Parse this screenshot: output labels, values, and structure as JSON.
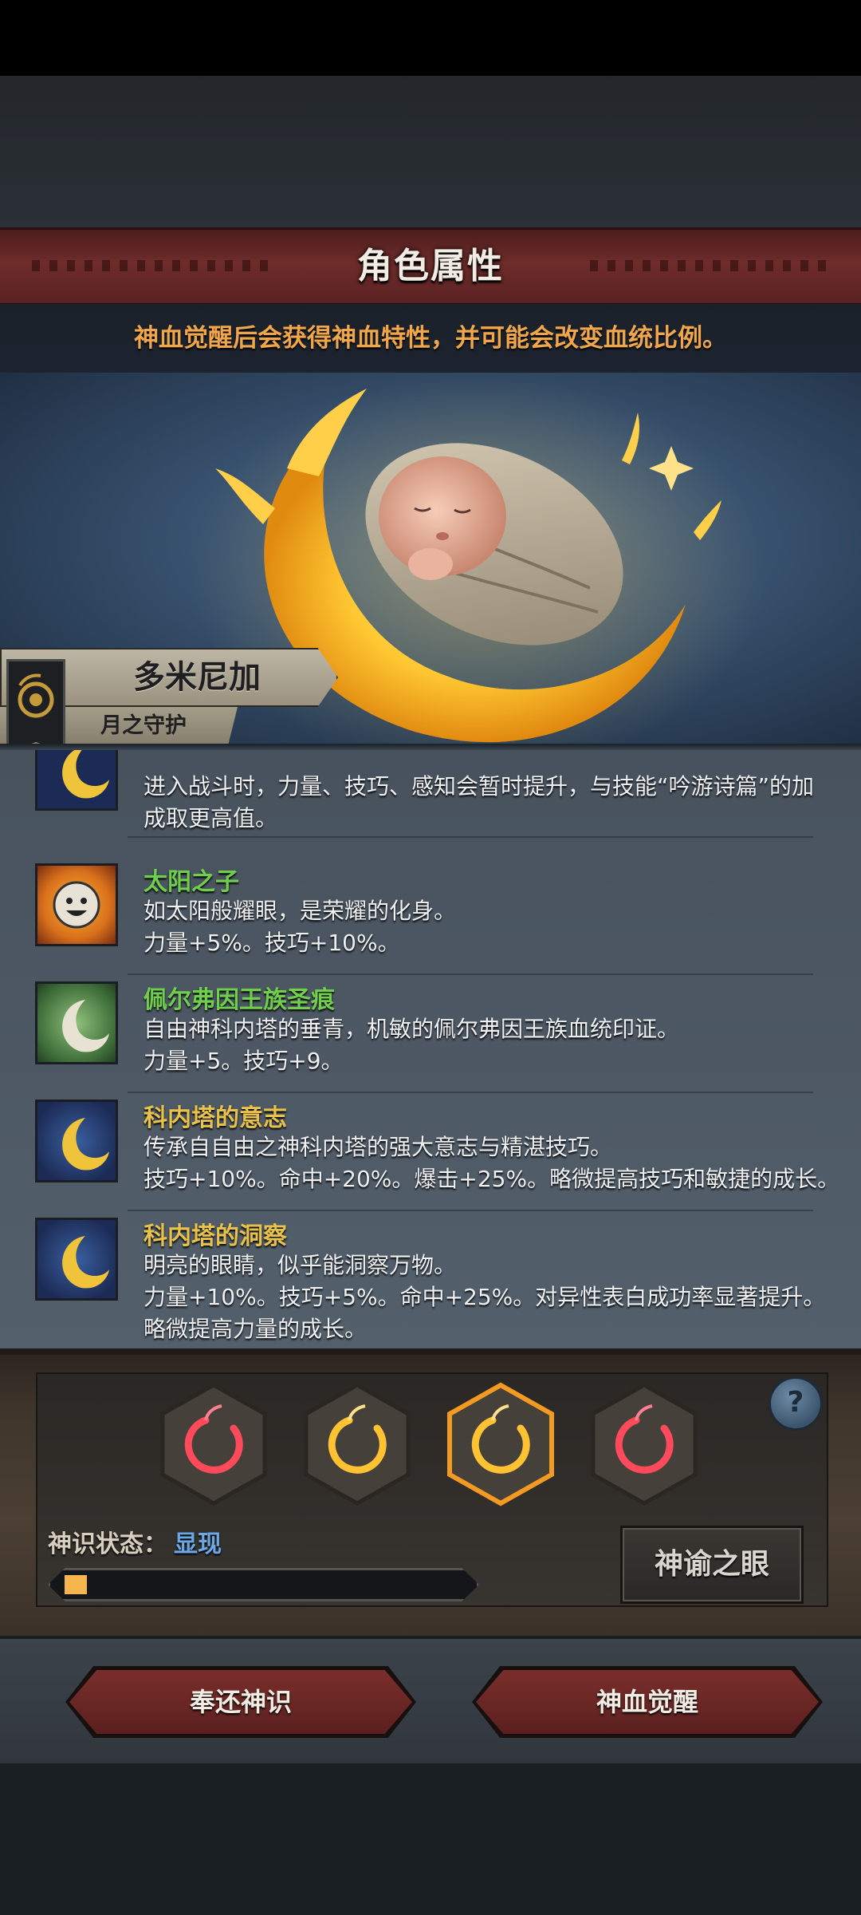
{
  "header": {
    "title": "角色属性",
    "subtitle": "神血觉醒后会获得神血特性，并可能会改变血统比例。"
  },
  "character": {
    "name": "多米尼加",
    "subtitle": "月之守护"
  },
  "traits": [
    {
      "name": "",
      "lines": [
        "进入战斗时，力量、技巧、感知会暂时提升，与技能“吟游诗篇”的加",
        "成取更高值。"
      ],
      "icon": "golden-moon-icon",
      "partial": true
    },
    {
      "name": "太阳之子",
      "color": "green",
      "lines": [
        "如太阳般耀眼，是荣耀的化身。",
        "力量+5%。技巧+10%。"
      ],
      "icon": "sun-face-icon"
    },
    {
      "name": "佩尔弗因王族圣痕",
      "color": "green",
      "lines": [
        "自由神科内塔的垂青，机敏的佩尔弗因王族血统印证。",
        "力量+5。技巧+9。"
      ],
      "icon": "silver-moon-icon"
    },
    {
      "name": "科内塔的意志",
      "color": "gold",
      "lines": [
        "传承自自由之神科内塔的强大意志与精湛技巧。",
        "技巧+10%。命中+20%。爆击+25%。略微提高技巧和敏捷的成长。"
      ],
      "icon": "golden-moon-icon"
    },
    {
      "name": "科内塔的洞察",
      "color": "gold",
      "lines": [
        "明亮的眼睛，似乎能洞察万物。",
        "力量+10%。技巧+5%。命中+25%。对异性表白成功率显著提升。",
        "略微提高力量的成长。"
      ],
      "icon": "golden-moon-icon"
    }
  ],
  "divine_slots": [
    {
      "color": "red",
      "selected": false
    },
    {
      "color": "gold",
      "selected": false
    },
    {
      "color": "gold",
      "selected": true
    },
    {
      "color": "red",
      "selected": false
    }
  ],
  "status": {
    "label": "神识状态：",
    "value": "显现",
    "progress": 0.05
  },
  "buttons": {
    "oracle_eye": "神谕之眼",
    "return": "奉还神识",
    "awaken": "神血觉醒",
    "help": "?"
  },
  "colors": {
    "trait_green": "#6fcf4c",
    "trait_gold": "#e8c24a",
    "subtitle_orange": "#f0a64a",
    "status_blue": "#6aa8e8",
    "banner_red": "#6e2c2a"
  }
}
